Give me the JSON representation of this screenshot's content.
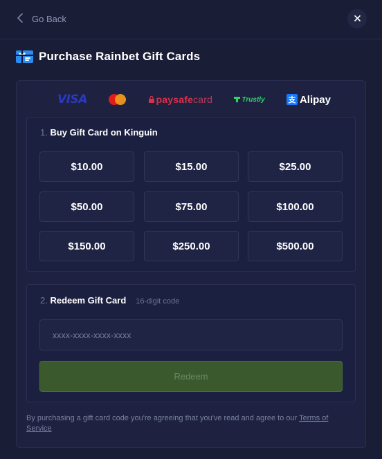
{
  "nav": {
    "back_label": "Go Back"
  },
  "header": {
    "title": "Purchase Rainbet Gift Cards"
  },
  "payment_logos": {
    "visa": "VISA",
    "paysafecard_a": "paysafe",
    "paysafecard_b": "card",
    "trustly": "Trustly",
    "alipay": "Alipay",
    "alipay_glyph": "支"
  },
  "step1": {
    "number": "1.",
    "title": "Buy Gift Card on Kinguin",
    "amounts": [
      "$10.00",
      "$15.00",
      "$25.00",
      "$50.00",
      "$75.00",
      "$100.00",
      "$150.00",
      "$250.00",
      "$500.00"
    ]
  },
  "step2": {
    "number": "2.",
    "title": "Redeem Gift Card",
    "hint": "16-digit code",
    "placeholder": "xxxx-xxxx-xxxx-xxxx",
    "button_label": "Redeem"
  },
  "footer": {
    "terms_text": "By purchasing a gift card code you're agreeing that you've read and agree to our ",
    "terms_link": "Terms of Service"
  },
  "colors": {
    "background": "#1a1d36",
    "panel": "#1e2240",
    "redeem_button": "#3a5a2e",
    "accent_blue": "#2a8cf0"
  }
}
